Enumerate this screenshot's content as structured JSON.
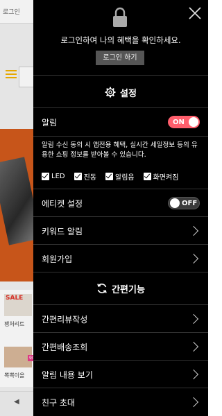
{
  "background": {
    "login_link": "로그인",
    "sale_text": "SALE",
    "item1_label": "팽처리트",
    "item2_label": "뽁뽁이올",
    "item2_badge": "90%",
    "back_label": "◀"
  },
  "drawer": {
    "login_message": "로그인하여 나의 혜택을 확인하세요.",
    "login_button": "로그인 하기",
    "settings_section": {
      "title": "설정",
      "icon": "gear-icon"
    },
    "notification": {
      "label": "알림",
      "toggle_label": "ON",
      "state": true,
      "description": "알림 수신 동의 시 앱전용 혜택, 실시간 세일정보 등의 유용한 쇼핑 정보를 받아볼 수 있습니다.",
      "options": [
        {
          "label": "LED",
          "checked": true
        },
        {
          "label": "진동",
          "checked": true
        },
        {
          "label": "알림음",
          "checked": true
        },
        {
          "label": "화면켜짐",
          "checked": true
        }
      ]
    },
    "etiquette": {
      "label": "에티켓 설정",
      "toggle_label": "OFF",
      "state": false
    },
    "keyword_alert": "키워드 알림",
    "signup": "회원가입",
    "quick_section": {
      "title": "간편기능",
      "icon": "refresh-icon"
    },
    "quick_items": [
      "간편리뷰작성",
      "간편배송조회",
      "알림 내용 보기",
      "친구 초대"
    ],
    "colors": {
      "drawer_bg": "#000000",
      "toggle_on": "#ff5e6c",
      "toggle_off": "#3a3a3a",
      "button_bg": "#555555"
    }
  }
}
